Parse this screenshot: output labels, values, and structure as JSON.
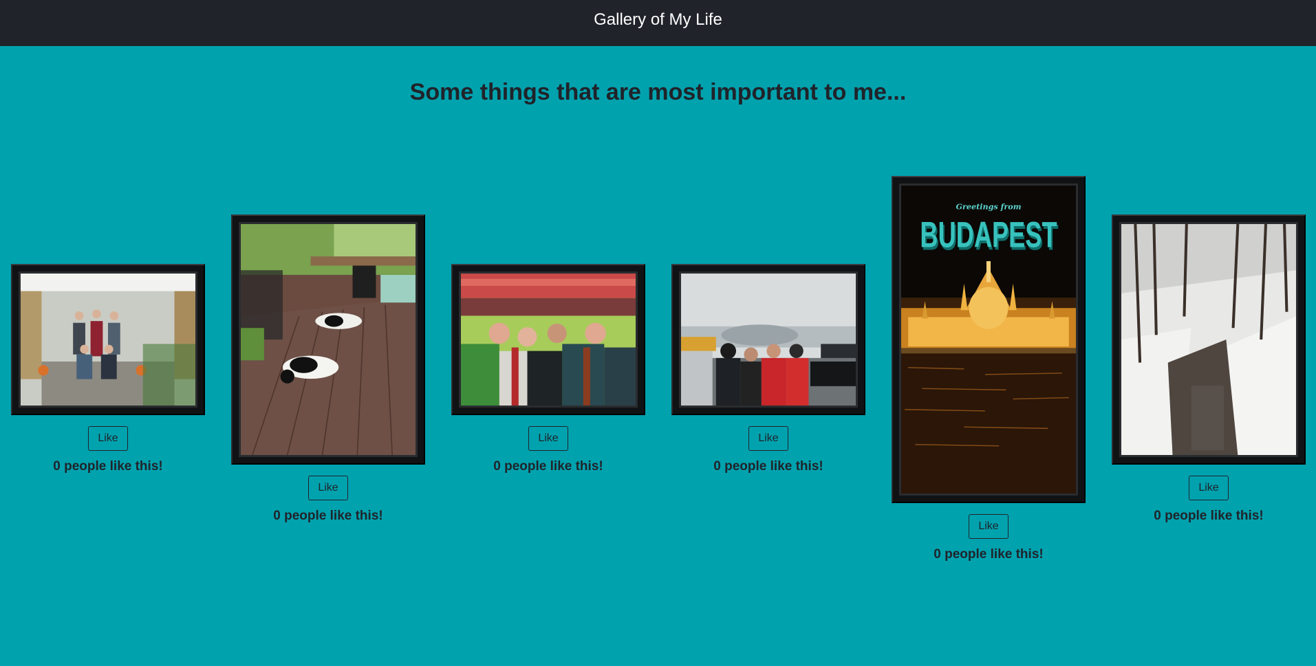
{
  "app": {
    "title": "Gallery of My Life"
  },
  "page": {
    "heading": "Some things that are most important to me..."
  },
  "colors": {
    "background": "#00a2ae",
    "navbar": "#20232a",
    "text": "#20232a",
    "frame": "#111214"
  },
  "photos": [
    {
      "subject": "family-on-porch-photo",
      "like_label": "Like",
      "likes_text": "0 people like this!"
    },
    {
      "subject": "dogs-on-deck-photo",
      "like_label": "Like",
      "likes_text": "0 people like this!"
    },
    {
      "subject": "soccer-stadium-selfie-photo",
      "like_label": "Like",
      "likes_text": "0 people like this!"
    },
    {
      "subject": "snowy-tailgate-photo",
      "like_label": "Like",
      "likes_text": "0 people like this!"
    },
    {
      "subject": "budapest-postcard-photo",
      "like_label": "Like",
      "likes_text": "0 people like this!",
      "postcard_small": "Greetings from",
      "postcard_big": "BUDAPEST"
    },
    {
      "subject": "snowy-creek-photo",
      "like_label": "Like",
      "likes_text": "0 people like this!"
    }
  ]
}
